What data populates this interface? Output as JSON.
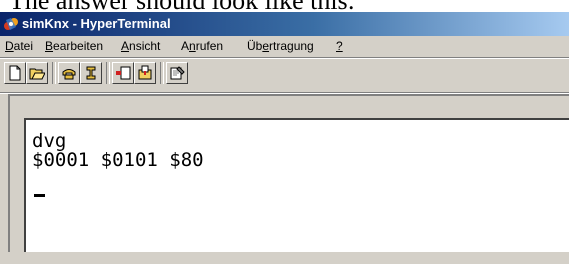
{
  "caption": "The answer should look like this:",
  "window": {
    "title": "simKnx - HyperTerminal"
  },
  "menu": [
    {
      "label": "Datei",
      "mnemonic_index": 0
    },
    {
      "label": "Bearbeiten",
      "mnemonic_index": 0
    },
    {
      "label": "Ansicht",
      "mnemonic_index": 0
    },
    {
      "label": "Anrufen",
      "mnemonic_index": 1
    },
    {
      "label": "Übertragung",
      "mnemonic_index": 2
    },
    {
      "label": "?",
      "mnemonic_index": 0
    }
  ],
  "toolbar_icons": [
    "new-icon",
    "open-icon",
    "connect-icon",
    "disconnect-icon",
    "send-icon",
    "receive-icon",
    "properties-icon"
  ],
  "terminal": {
    "lines": [
      "dvg",
      "$0001 $0101 $80"
    ]
  },
  "colors": {
    "titlebar_start": "#0a246a",
    "titlebar_end": "#a6caf0",
    "chrome": "#d4d0c8"
  }
}
